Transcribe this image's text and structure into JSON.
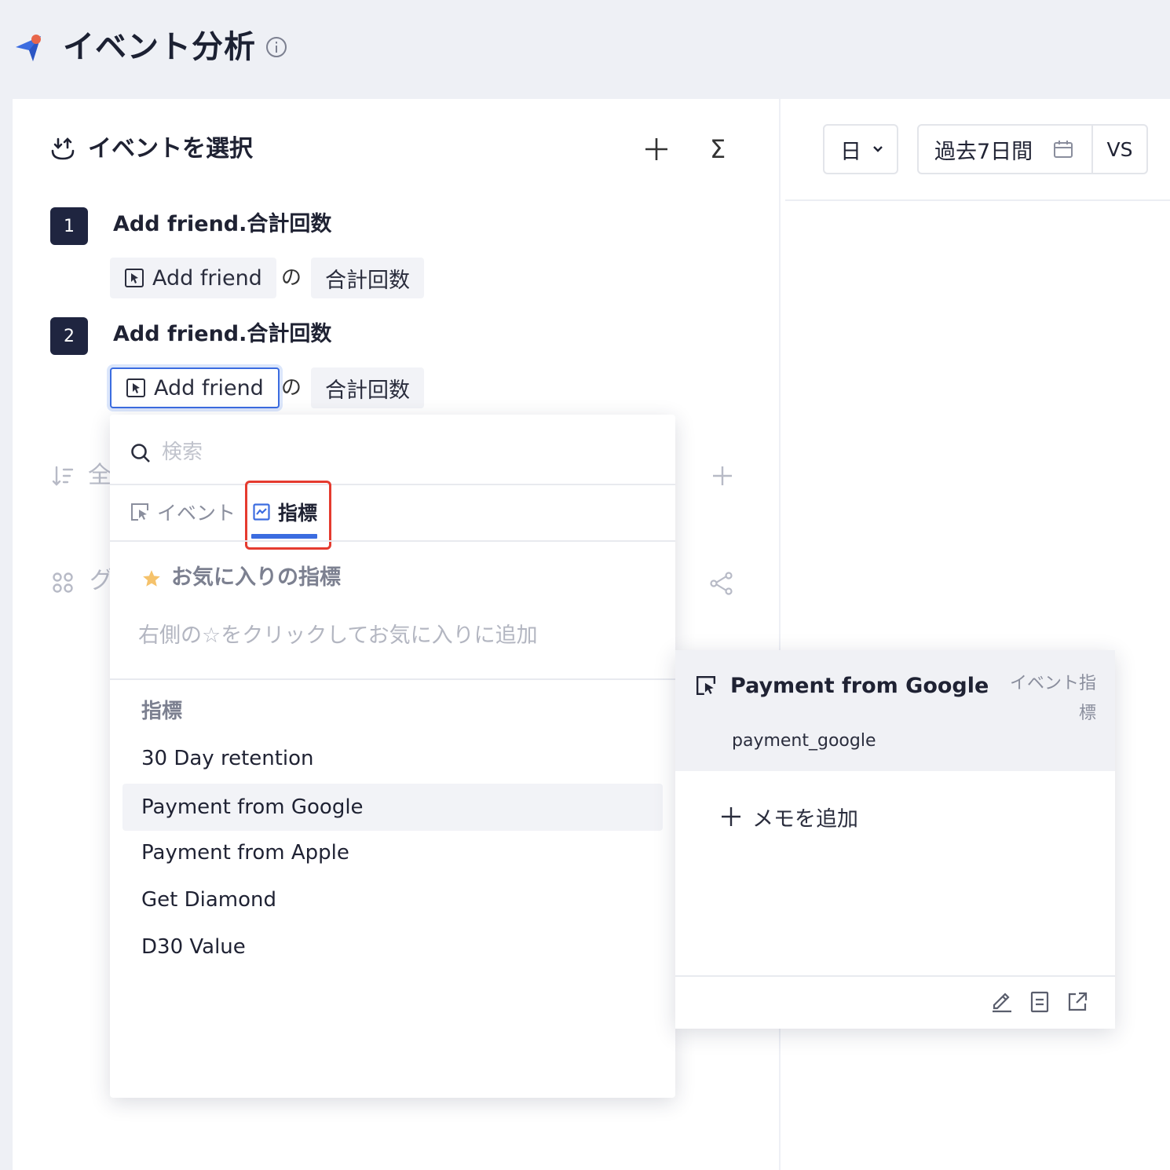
{
  "header": {
    "title": "イベント分析"
  },
  "left_panel": {
    "title": "イベントを選択",
    "sigma_label": "Σ",
    "metrics": [
      {
        "number": "1",
        "name": "Add friend.合計回数",
        "event_chip": "Add friend",
        "connector": "の",
        "aggregation": "合計回数"
      },
      {
        "number": "2",
        "name": "Add friend.合計回数",
        "event_chip": "Add friend",
        "connector": "の",
        "aggregation": "合計回数"
      }
    ],
    "filter_label": "全",
    "group_label": "グ"
  },
  "dropdown": {
    "search_placeholder": "検索",
    "tabs": [
      {
        "label": "イベント"
      },
      {
        "label": "指標"
      }
    ],
    "active_tab": "指標",
    "favorites_title": "お気に入りの指標",
    "favorites_hint": "右側の☆をクリックしてお気に入りに追加",
    "metrics_heading": "指標",
    "items": [
      "30 Day retention",
      "Payment from Google",
      "Payment from Apple",
      "Get Diamond",
      "D30 Value"
    ],
    "hovered_item": "Payment from Google"
  },
  "detail_card": {
    "title": "Payment from Google",
    "type_line1": "イベント指",
    "type_line2": "標",
    "key": "payment_google",
    "add_memo": "メモを追加"
  },
  "toolbar": {
    "granularity": "日",
    "date_range": "過去7日間",
    "vs_label": "VS"
  },
  "colors": {
    "accent": "#3b6ce0",
    "highlight": "#e53b2f",
    "badge": "#1f2540",
    "star": "#f5c26b"
  }
}
